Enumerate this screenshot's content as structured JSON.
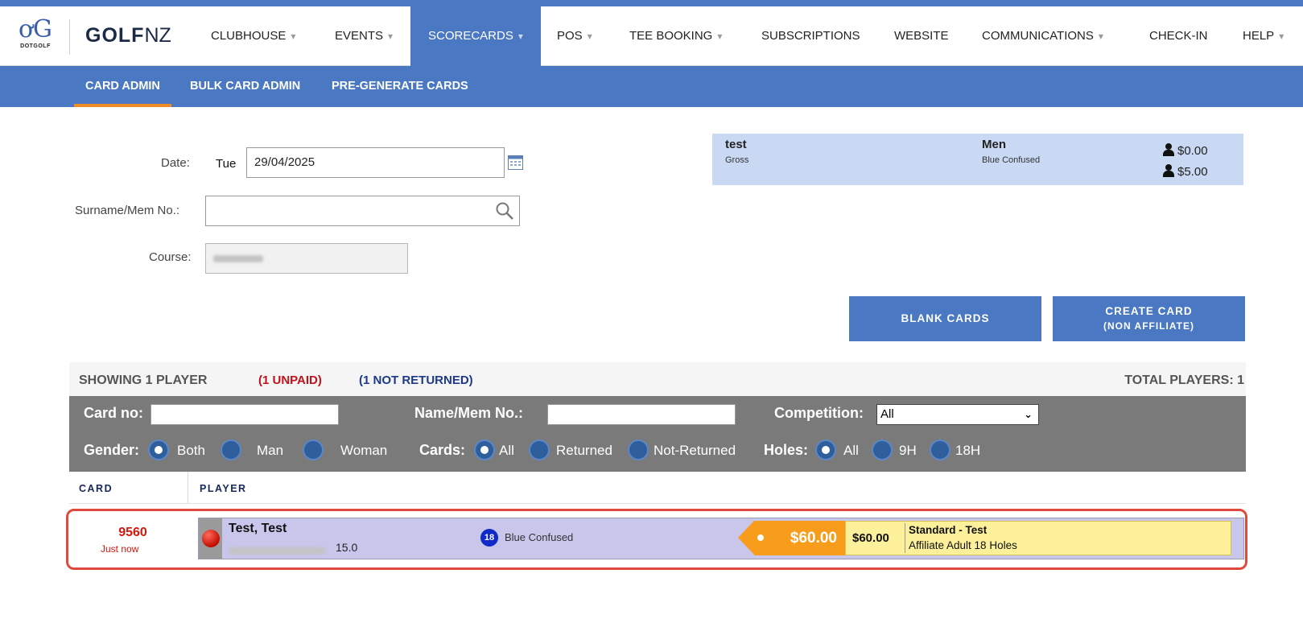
{
  "brand": {
    "logo_text": "DOTGOLF",
    "partner_logo": {
      "bold": "GOLF",
      "light": "NZ"
    }
  },
  "nav": {
    "items": [
      {
        "label": "CLUBHOUSE",
        "has_caret": true
      },
      {
        "label": "EVENTS",
        "has_caret": true
      },
      {
        "label": "SCORECARDS",
        "has_caret": true,
        "active": true
      },
      {
        "label": "POS",
        "has_caret": true
      },
      {
        "label": "TEE BOOKING",
        "has_caret": true
      },
      {
        "label": "SUBSCRIPTIONS",
        "has_caret": false
      },
      {
        "label": "WEBSITE",
        "has_caret": false
      },
      {
        "label": "COMMUNICATIONS",
        "has_caret": true
      },
      {
        "label": "CHECK-IN",
        "has_caret": false
      },
      {
        "label": "HELP",
        "has_caret": true
      }
    ],
    "caret_glyph": "▾"
  },
  "subnav": {
    "items": [
      {
        "label": "CARD ADMIN",
        "active": true
      },
      {
        "label": "BULK CARD ADMIN"
      },
      {
        "label": "PRE-GENERATE CARDS"
      }
    ]
  },
  "form": {
    "date_label": "Date:",
    "day": "Tue",
    "date_value": "29/04/2025",
    "surname_label": "Surname/Mem No.:",
    "surname_value": "",
    "course_label": "Course:"
  },
  "info_card": {
    "competition_name": "test",
    "competition_type": "Gross",
    "gender": "Men",
    "tee": "Blue Confused",
    "price_member": "$0.00",
    "price_guest": "$5.00"
  },
  "buttons": {
    "blank_cards": "BLANK CARDS",
    "create_card_line1": "CREATE CARD",
    "create_card_line2": "(NON AFFILIATE)"
  },
  "summary": {
    "showing": "SHOWING 1 PLAYER",
    "unpaid": "(1 UNPAID)",
    "not_returned": "(1 NOT RETURNED)",
    "total": "TOTAL PLAYERS: 1"
  },
  "filters": {
    "card_no_label": "Card no:",
    "card_no_value": "",
    "name_label": "Name/Mem No.:",
    "name_value": "",
    "competition_label": "Competition:",
    "competition_selected": "All",
    "gender_label": "Gender:",
    "gender_options": [
      "Both",
      "Man",
      "Woman"
    ],
    "gender_selected": "Both",
    "cards_label": "Cards:",
    "cards_options": [
      "All",
      "Returned",
      "Not-Returned"
    ],
    "cards_selected": "All",
    "holes_label": "Holes:",
    "holes_options": [
      "All",
      "9H",
      "18H"
    ],
    "holes_selected": "All"
  },
  "table": {
    "headers": {
      "card": "CARD",
      "player": "PLAYER"
    },
    "rows": [
      {
        "card_no": "9560",
        "card_time": "Just now",
        "player_name": "Test, Test",
        "handicap": "15.0",
        "holes": "18",
        "tee": "Blue Confused",
        "tag_price": "$60.00",
        "price": "$60.00",
        "fee_title": "Standard - Test",
        "fee_desc": "Affiliate Adult 18 Holes"
      }
    ]
  },
  "colors": {
    "primary_blue": "#4a78c2",
    "active_underline": "#ef8a26",
    "unpaid_red": "#c0121a",
    "not_returned_blue": "#1d3a8a",
    "row_highlight": "#e04a3c",
    "price_tag": "#f89c1c",
    "fee_box": "#fdf09b"
  }
}
